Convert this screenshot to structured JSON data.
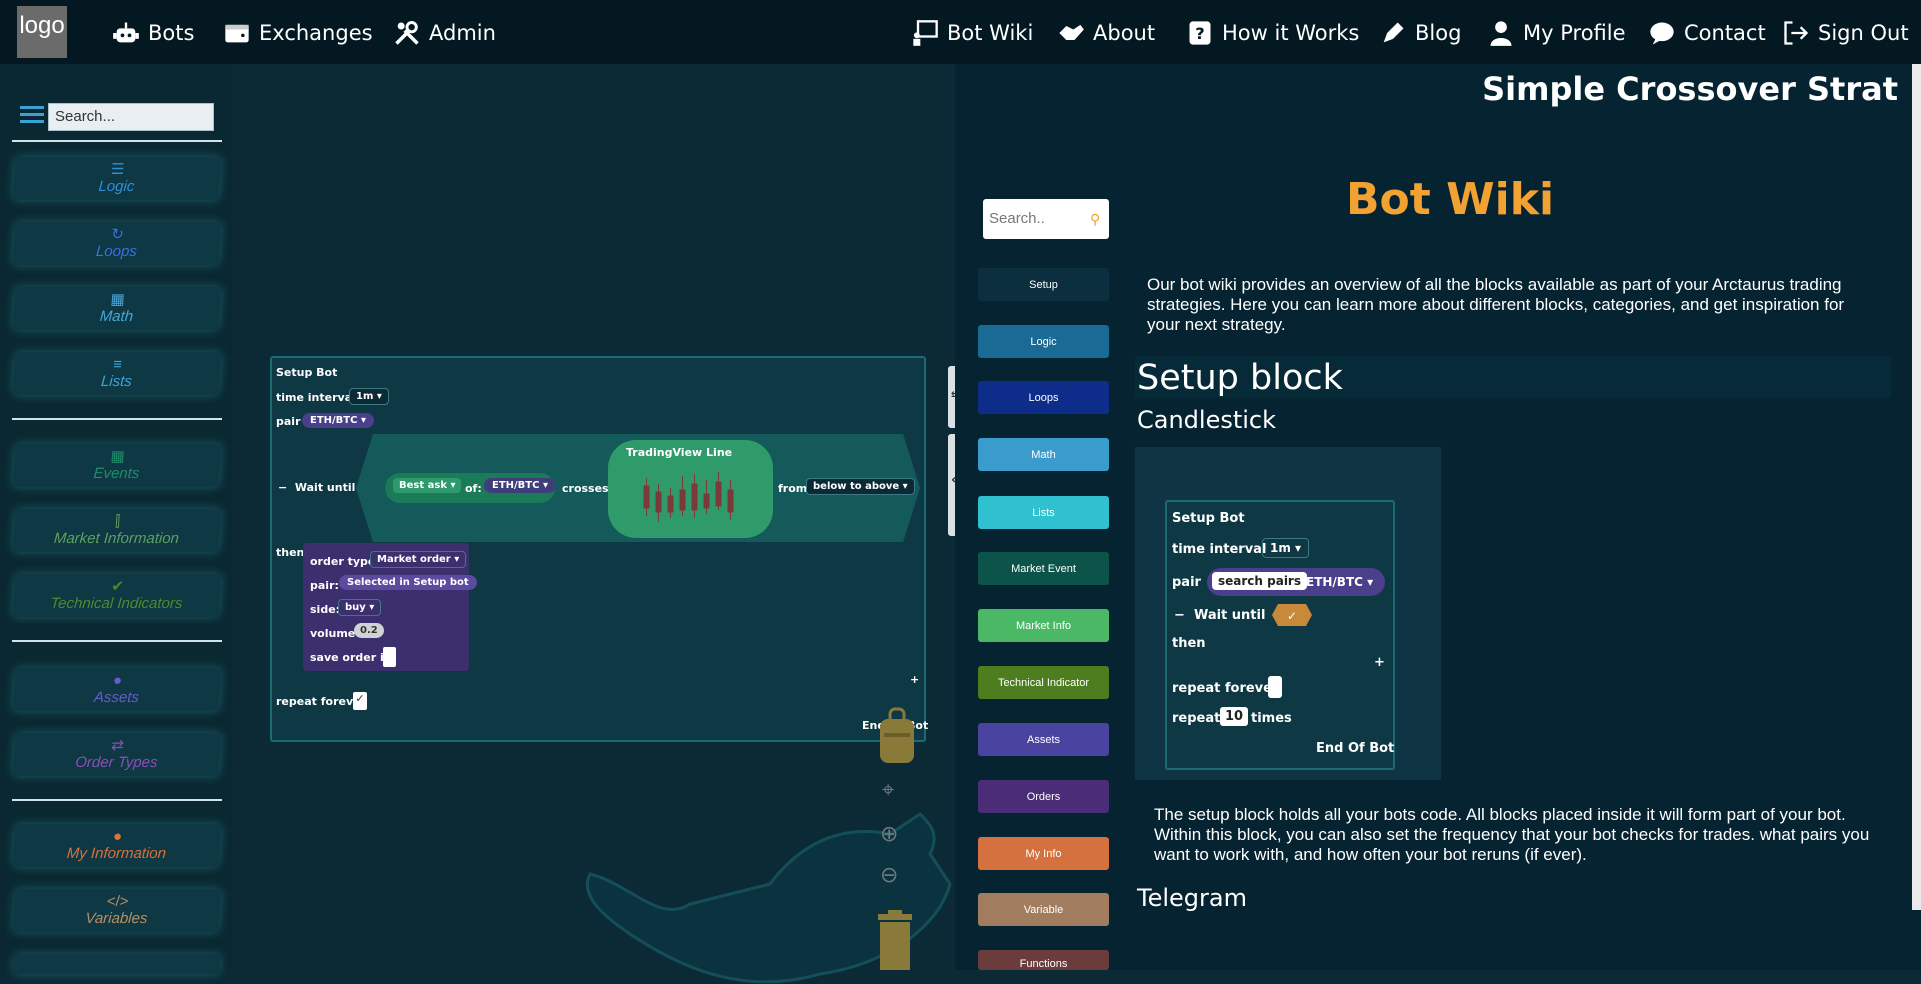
{
  "nav": {
    "logo": "logo",
    "left_items": [
      {
        "label": "Bots",
        "icon": "robot-icon"
      },
      {
        "label": "Exchanges",
        "icon": "wallet-icon"
      },
      {
        "label": "Admin",
        "icon": "tools-icon"
      }
    ],
    "right_items": [
      {
        "label": "Bot Wiki",
        "icon": "teacher-board-icon"
      },
      {
        "label": "About",
        "icon": "handshake-icon"
      },
      {
        "label": "How it Works",
        "icon": "question-icon"
      },
      {
        "label": "Blog",
        "icon": "pen-icon"
      },
      {
        "label": "My Profile",
        "icon": "user-icon"
      },
      {
        "label": "Contact",
        "icon": "chat-bubble-icon"
      },
      {
        "label": "Sign Out",
        "icon": "sign-out-icon"
      }
    ]
  },
  "toolbox": {
    "search_placeholder": "Search...",
    "categories": [
      {
        "label": "Logic",
        "icon": "☰",
        "color": "#2f8fd6"
      },
      {
        "label": "Loops",
        "icon": "↻",
        "color": "#3b6fe0"
      },
      {
        "label": "Math",
        "icon": "▦",
        "color": "#4aa7d6"
      },
      {
        "label": "Lists",
        "icon": "≡",
        "color": "#3aa8d8"
      },
      {
        "label": "Events",
        "icon": "▦",
        "color": "#1f8c6c"
      },
      {
        "label": "Market Information",
        "icon": "⫿",
        "color": "#5ea060"
      },
      {
        "label": "Technical Indicators",
        "icon": "✔",
        "color": "#4f8a2c"
      },
      {
        "label": "Assets",
        "icon": "●",
        "color": "#6a5acd"
      },
      {
        "label": "Order Types",
        "icon": "⇄",
        "color": "#8a4fb8"
      },
      {
        "label": "My Information",
        "icon": "●",
        "color": "#d9733a"
      },
      {
        "label": "Variables",
        "icon": "</>",
        "color": "#b59065"
      }
    ]
  },
  "workspace": {
    "setup_title": "Setup Bot",
    "time_interval_label": "time interval",
    "time_interval_value": "1m",
    "pair_label": "pair",
    "pair_value": "ETH/BTC",
    "wait_until": "Wait until",
    "best_ask": "Best ask",
    "of_label": "of:",
    "of_value": "ETH/BTC",
    "crosses": "crosses",
    "tv_title": "TradingView Line",
    "from_label": "from",
    "from_value": "below to above",
    "then": "then",
    "order_type_label": "order type:",
    "order_type_value": "Market order",
    "order_pair_label": "pair:",
    "order_pair_value": "Selected in Setup bot",
    "side_label": "side:",
    "side_value": "buy",
    "volume_label": "volume",
    "volume_value": "0.2",
    "save_order_label": "save order id:",
    "plus": "+",
    "repeat_forever": "repeat forever",
    "end_of_bot": "End Of Bot"
  },
  "wiki": {
    "strategy_title": "Simple Crossover Strat",
    "search_placeholder": "Search..",
    "title": "Bot Wiki",
    "intro": "Our bot wiki provides an overview of all the blocks available as part of your Arctaurus trading strategies. Here you can learn more about different blocks, categories, and get inspiration for your next strategy.",
    "buttons": [
      {
        "label": "Setup",
        "color": "#0b2f3e"
      },
      {
        "label": "Logic",
        "color": "#1a6a96"
      },
      {
        "label": "Loops",
        "color": "#0e2d8a"
      },
      {
        "label": "Math",
        "color": "#3a9ccc"
      },
      {
        "label": "Lists",
        "color": "#2fc1cf"
      },
      {
        "label": "Market Event",
        "color": "#0c5449"
      },
      {
        "label": "Market Info",
        "color": "#4bb865"
      },
      {
        "label": "Technical Indicator",
        "color": "#4d7d1e"
      },
      {
        "label": "Assets",
        "color": "#4a44a0"
      },
      {
        "label": "Orders",
        "color": "#4a2c78"
      },
      {
        "label": "My Info",
        "color": "#d4713e"
      },
      {
        "label": "Variable",
        "color": "#a27c5e"
      },
      {
        "label": "Functions",
        "color": "#6a3c3c"
      }
    ],
    "setup_heading": "Setup block",
    "candlestick_heading": "Candlestick",
    "demo": {
      "title": "Setup Bot",
      "time_interval_label": "time interval",
      "time_interval_value": "1m",
      "pair_label": "pair",
      "search_pairs": "search pairs",
      "pair_value": "ETH/BTC",
      "wait_until": "Wait until",
      "then": "then",
      "plus": "+",
      "repeat_forever": "repeat forever",
      "repeat_label": "repeat",
      "repeat_count": "10",
      "times": "times",
      "end_of_bot": "End Of Bot"
    },
    "setup_description": "The setup block holds all your bots code. All blocks placed inside it will form part of your bot. Within this block, you can also set the frequency that your bot checks for trades. what pairs you want to work with, and how often your bot reruns (if ever).",
    "telegram_heading": "Telegram"
  }
}
